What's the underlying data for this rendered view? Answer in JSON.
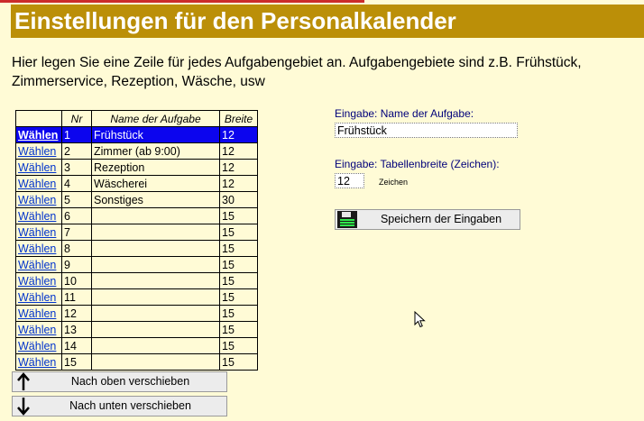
{
  "header": {
    "title": "Einstellungen für den Personalkalender"
  },
  "intro": "Hier legen Sie eine Zeile für jedes Aufgabengebiet an. Aufgabengebiete sind z.B. Frühstück, Zimmerservice, Rezeption, Wäsche, usw",
  "table": {
    "columns": [
      "",
      "Nr",
      "Name der Aufgabe",
      "Breite"
    ],
    "select_label": "Wählen",
    "rows": [
      {
        "nr": "1",
        "name": "Frühstück",
        "width": "12",
        "selected": true
      },
      {
        "nr": "2",
        "name": "Zimmer (ab 9:00)",
        "width": "12"
      },
      {
        "nr": "3",
        "name": "Rezeption",
        "width": "12"
      },
      {
        "nr": "4",
        "name": "Wäscherei",
        "width": "12"
      },
      {
        "nr": "5",
        "name": "Sonstiges",
        "width": "30"
      },
      {
        "nr": "6",
        "name": "",
        "width": "15"
      },
      {
        "nr": "7",
        "name": "",
        "width": "15"
      },
      {
        "nr": "8",
        "name": "",
        "width": "15"
      },
      {
        "nr": "9",
        "name": "",
        "width": "15"
      },
      {
        "nr": "10",
        "name": "",
        "width": "15"
      },
      {
        "nr": "11",
        "name": "",
        "width": "15"
      },
      {
        "nr": "12",
        "name": "",
        "width": "15"
      },
      {
        "nr": "13",
        "name": "",
        "width": "15"
      },
      {
        "nr": "14",
        "name": "",
        "width": "15"
      },
      {
        "nr": "15",
        "name": "",
        "width": "15"
      }
    ]
  },
  "buttons": {
    "move_up": "Nach oben verschieben",
    "move_down": "Nach unten verschieben",
    "save": "Speichern der Eingaben"
  },
  "form": {
    "name_label": "Eingabe: Name der Aufgabe:",
    "name_value": "Frühstück",
    "width_label": "Eingabe: Tabellenbreite (Zeichen):",
    "width_value": "12",
    "width_unit": "Zeichen"
  },
  "colors": {
    "header_bg": "#bb8f08",
    "page_bg": "#fffbd6",
    "selection": "#0c05ee",
    "link": "#0033cc",
    "label": "#00007a"
  },
  "icons": [
    "arrow-up-icon",
    "arrow-down-icon",
    "floppy-disk-icon",
    "mouse-pointer-icon"
  ]
}
